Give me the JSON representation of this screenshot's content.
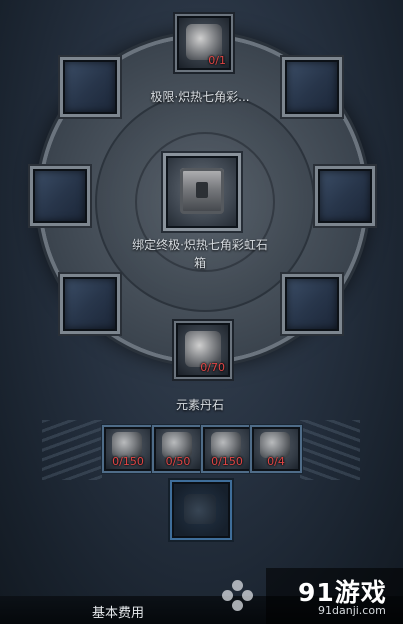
{
  "recipe": {
    "top_item": {
      "count": "0/1",
      "label": "极限·炽热七角彩..."
    },
    "center_item": {
      "label_line1": "绑定终极·炽热七角彩虹石",
      "label_line2": "箱"
    },
    "middle_item": {
      "count": "0/70",
      "label": "元素丹石"
    },
    "materials": [
      {
        "count": "0/150"
      },
      {
        "count": "0/50"
      },
      {
        "count": "0/150"
      },
      {
        "count": "0/4"
      }
    ]
  },
  "footer": {
    "label": "基本费用"
  },
  "watermark": {
    "logo": "91游戏",
    "site": "91danji.com"
  },
  "colors": {
    "count_red": "#e04545",
    "slot_blue": "#2d3e55",
    "frame_silver": "#7d868f"
  }
}
